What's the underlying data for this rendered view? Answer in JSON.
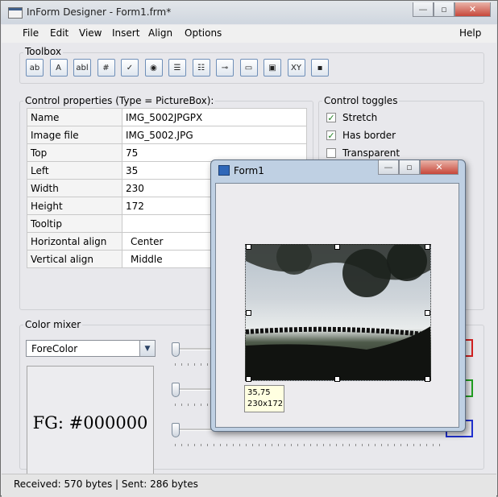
{
  "app": {
    "title": "InForm Designer - Form1.frm*",
    "caption_buttons": [
      "—",
      "▫",
      "✕"
    ]
  },
  "menu": [
    "File",
    "Edit",
    "View",
    "Insert",
    "Align",
    "Options"
  ],
  "menu_help": "Help",
  "toolbox": {
    "label": "Toolbox",
    "tools": [
      {
        "name": "label-tool-icon",
        "glyph": "ab"
      },
      {
        "name": "text-label-tool-icon",
        "glyph": "A"
      },
      {
        "name": "textbox-tool-icon",
        "glyph": "abl"
      },
      {
        "name": "frame-tool-icon",
        "glyph": "#"
      },
      {
        "name": "checkbox-tool-icon",
        "glyph": "✓"
      },
      {
        "name": "radio-tool-icon",
        "glyph": "◉"
      },
      {
        "name": "combobox-tool-icon",
        "glyph": "☰"
      },
      {
        "name": "listbox-tool-icon",
        "glyph": "☷"
      },
      {
        "name": "trackbar-tool-icon",
        "glyph": "⊸"
      },
      {
        "name": "progressbar-tool-icon",
        "glyph": "▭"
      },
      {
        "name": "picturebox-tool-icon",
        "glyph": "▣"
      },
      {
        "name": "image-tool-icon",
        "glyph": "XY"
      },
      {
        "name": "toggle-tool-icon",
        "glyph": "▪"
      }
    ]
  },
  "properties": {
    "label": "Control properties (Type = PictureBox):",
    "rows": [
      {
        "key": "Name",
        "value": "IMG_5002JPGPX"
      },
      {
        "key": "Image file",
        "value": "IMG_5002.JPG"
      },
      {
        "key": "Top",
        "value": "75"
      },
      {
        "key": "Left",
        "value": "35"
      },
      {
        "key": "Width",
        "value": "230"
      },
      {
        "key": "Height",
        "value": "172"
      },
      {
        "key": "Tooltip",
        "value": ""
      },
      {
        "key": "Horizontal align",
        "value": "Center"
      },
      {
        "key": "Vertical align",
        "value": "Middle"
      }
    ]
  },
  "toggles": {
    "label": "Control toggles",
    "items": [
      {
        "label": "Stretch",
        "checked": true
      },
      {
        "label": "Has border",
        "checked": true
      },
      {
        "label": "Transparent",
        "checked": false
      }
    ]
  },
  "color_mixer": {
    "label": "Color mixer",
    "selected": "ForeColor",
    "preview_text": "FG: #000000",
    "slider_levels_percent": [
      0,
      0,
      0
    ],
    "channel_colors": [
      "#d42020",
      "#20a020",
      "#2030d0"
    ]
  },
  "form_window": {
    "title": "Form1",
    "caption_buttons": [
      "—",
      "▫",
      "✕"
    ],
    "tooltip_line1": "35,75",
    "tooltip_line2": "230x172"
  },
  "status": {
    "text": "Received: 570 bytes | Sent: 286 bytes"
  }
}
